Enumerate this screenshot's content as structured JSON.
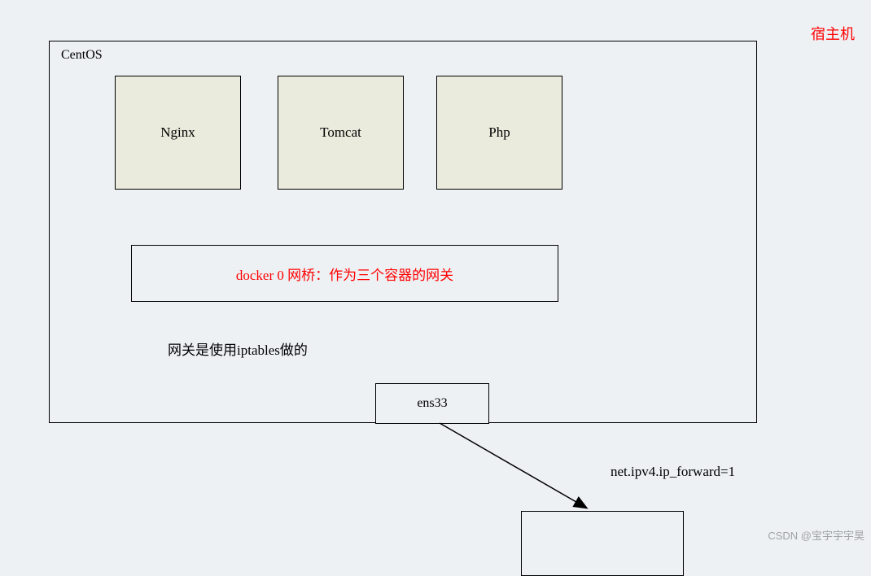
{
  "host_label": "宿主机",
  "centos": {
    "label": "CentOS",
    "containers": [
      {
        "name": "Nginx"
      },
      {
        "name": "Tomcat"
      },
      {
        "name": "Php"
      }
    ],
    "bridge_text": "docker 0 网桥：作为三个容器的网关",
    "gateway_note": "网关是使用iptables做的",
    "nic": "ens33"
  },
  "forward_setting": "net.ipv4.ip_forward=1",
  "watermark": "CSDN @宝宇宇宇昊"
}
